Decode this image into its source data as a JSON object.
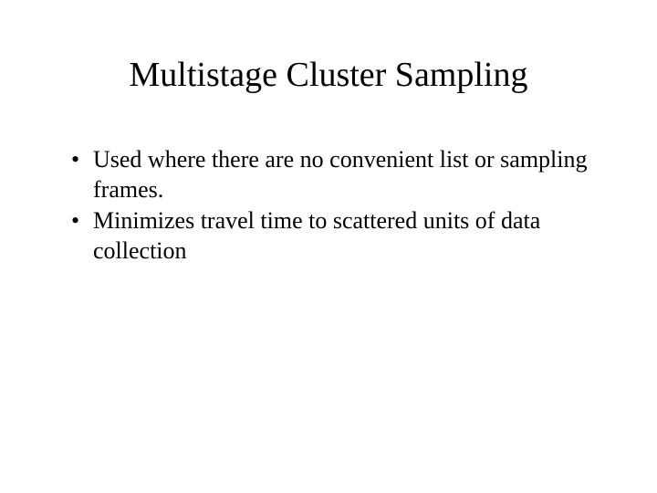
{
  "slide": {
    "title": "Multistage Cluster Sampling",
    "bullets": [
      "Used where there are no convenient list or sampling frames.",
      "Minimizes travel time to scattered units of data collection"
    ]
  }
}
